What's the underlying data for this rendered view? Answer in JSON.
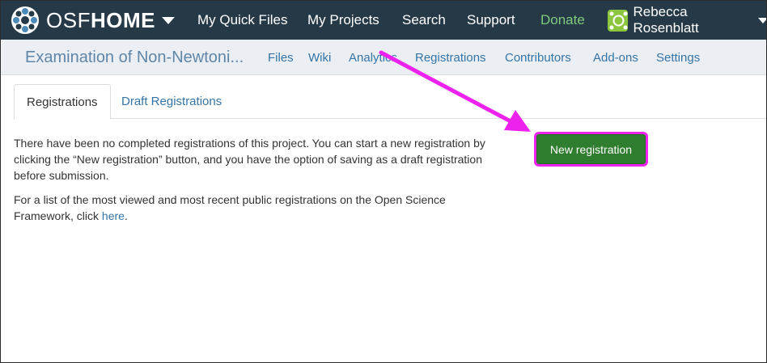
{
  "brand": {
    "osf": "OSF",
    "home": "HOME"
  },
  "topnav": {
    "quick_files": "My Quick Files",
    "projects": "My Projects",
    "search": "Search",
    "support": "Support",
    "donate": "Donate"
  },
  "user": {
    "name": "Rebecca Rosenblatt"
  },
  "project": {
    "title": "Examination of Non-Newtoni...",
    "nav": {
      "files": "Files",
      "wiki": "Wiki",
      "analytics": "Analytics",
      "registrations": "Registrations",
      "contributors": "Contributors",
      "addons": "Add-ons",
      "settings": "Settings"
    }
  },
  "tabs": {
    "registrations": "Registrations",
    "drafts": "Draft Registrations"
  },
  "content": {
    "p1_line1": "There have been no completed registrations of this project. You can start a new registration by",
    "p1_line2": "clicking the “New registration” button, and you have the option of saving as a draft registration",
    "p1_line3": "before submission.",
    "p2_line1": "For a list of the most viewed and most recent public registrations on the Open Science",
    "p2_prefix": "Framework, click ",
    "p2_link": "here",
    "p2_suffix": "."
  },
  "button": {
    "new_registration": "New registration"
  },
  "colors": {
    "navbar": "#263947",
    "projbar": "#ebeff3",
    "button": "#2f7d2f",
    "highlight": "#ee22ee",
    "donate": "#7ecb7e"
  }
}
